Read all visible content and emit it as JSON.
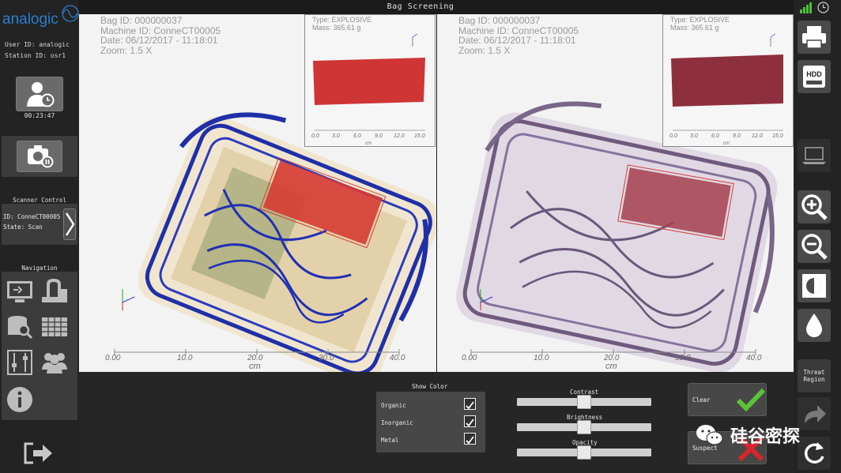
{
  "window": {
    "title": "Bag Screening"
  },
  "brand": {
    "logo_text": "analogic"
  },
  "user": {
    "user_id": "User ID: analogic",
    "station_id": "Station ID: osr1"
  },
  "session": {
    "timer": "00:23:47"
  },
  "scanner": {
    "section_title": "Scanner Control",
    "id": "ID: ConneCT00005",
    "state": "State: Scan"
  },
  "navigation": {
    "section_title": "Navigation"
  },
  "views": [
    {
      "bag_id": "Bag ID: 000000037",
      "machine_id": "Machine ID: ConneCT00005",
      "date": "Date: 06/12/2017 - 11:18:01",
      "zoom": "Zoom: 1.5 X",
      "threat_type": "Type: EXPLOSIVE",
      "threat_mass": "Mass: 365.61 g",
      "axis_ticks": [
        "0.00",
        "10.0",
        "20.0",
        "30.0",
        "40.0"
      ],
      "axis_unit": "cm",
      "inset_ticks": [
        "0.0",
        "3.0",
        "6.0",
        "9.0",
        "12.0",
        "15.0"
      ],
      "inset_unit": "cm"
    },
    {
      "bag_id": "Bag ID: 000000037",
      "machine_id": "Machine ID: ConneCT00005",
      "date": "Date: 06/12/2017 - 11:18:01",
      "zoom": "Zoom: 1.5 X",
      "threat_type": "Type: EXPLOSIVE",
      "threat_mass": "Mass: 365.61 g",
      "axis_ticks": [
        "0.00",
        "10.0",
        "20.0",
        "30.0",
        "40.0"
      ],
      "axis_unit": "cm",
      "inset_ticks": [
        "0.0",
        "3.0",
        "6.0",
        "9.0",
        "12.0",
        "15.0"
      ],
      "inset_unit": "cm"
    }
  ],
  "show_color": {
    "title": "Show Color",
    "options": [
      {
        "label": "Organic",
        "checked": true
      },
      {
        "label": "Inorganic",
        "checked": true
      },
      {
        "label": "Metal",
        "checked": true
      }
    ]
  },
  "sliders": [
    {
      "label": "Contrast",
      "value": 0.5
    },
    {
      "label": "Brightness",
      "value": 0.5
    },
    {
      "label": "Opacity",
      "value": 0.5
    }
  ],
  "actions": {
    "clear": "Clear",
    "suspect": "Suspect"
  },
  "right_toolbar": {
    "hdd_label": "HDD",
    "threat_region": "Threat Region"
  },
  "watermark": {
    "text": "硅谷密探"
  },
  "colors": {
    "organic_view": "#1f2fa8",
    "threat_region": "#d63a32",
    "clear_check": "#5cc23a",
    "suspect_x": "#d8252b"
  }
}
